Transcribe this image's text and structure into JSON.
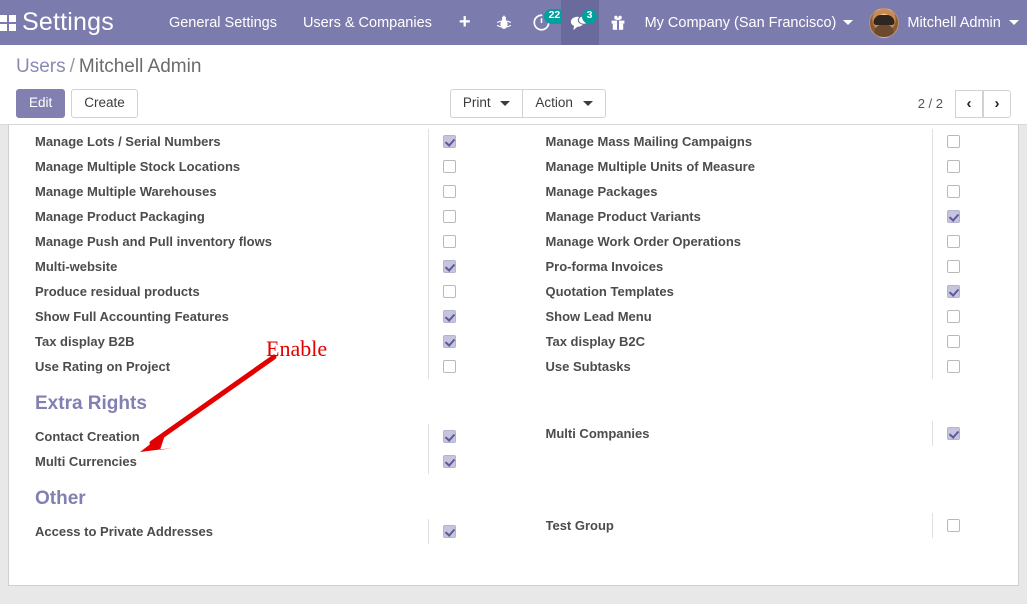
{
  "navbar": {
    "apps_icon": "apps-grid-icon",
    "app_title": "Settings",
    "menu_items": [
      {
        "label": "General Settings"
      },
      {
        "label": "Users & Companies"
      }
    ],
    "add_label": "+",
    "sys_icons": [
      {
        "name": "bug-icon",
        "glyph": "🐞",
        "badge": null,
        "active": false
      },
      {
        "name": "activity-clock-icon",
        "glyph": "⟳",
        "badge": "22",
        "active": false
      },
      {
        "name": "messages-icon",
        "glyph": "💬",
        "badge": "3",
        "active": true
      },
      {
        "name": "gift-icon",
        "glyph": "🎁",
        "badge": null,
        "active": false
      }
    ],
    "company": "My Company (San Francisco)",
    "user": "Mitchell Admin"
  },
  "control_panel": {
    "breadcrumb_root": "Users",
    "breadcrumb_sep": "/",
    "breadcrumb_current": "Mitchell Admin",
    "edit_label": "Edit",
    "create_label": "Create",
    "print_label": "Print",
    "action_label": "Action",
    "pager_count": "2 / 2",
    "prev_glyph": "‹",
    "next_glyph": "›"
  },
  "form": {
    "left_column": [
      {
        "label": "Manage Lots / Serial Numbers",
        "checked": true
      },
      {
        "label": "Manage Multiple Stock Locations",
        "checked": false
      },
      {
        "label": "Manage Multiple Warehouses",
        "checked": false
      },
      {
        "label": "Manage Product Packaging",
        "checked": false
      },
      {
        "label": "Manage Push and Pull inventory flows",
        "checked": false
      },
      {
        "label": "Multi-website",
        "checked": true
      },
      {
        "label": "Produce residual products",
        "checked": false
      },
      {
        "label": "Show Full Accounting Features",
        "checked": true
      },
      {
        "label": "Tax display B2B",
        "checked": true
      },
      {
        "label": "Use Rating on Project",
        "checked": false
      }
    ],
    "right_column": [
      {
        "label": "Manage Mass Mailing Campaigns",
        "checked": false
      },
      {
        "label": "Manage Multiple Units of Measure",
        "checked": false
      },
      {
        "label": "Manage Packages",
        "checked": false
      },
      {
        "label": "Manage Product Variants",
        "checked": true
      },
      {
        "label": "Manage Work Order Operations",
        "checked": false
      },
      {
        "label": "Pro-forma Invoices",
        "checked": false
      },
      {
        "label": "Quotation Templates",
        "checked": true
      },
      {
        "label": "Show Lead Menu",
        "checked": false
      },
      {
        "label": "Tax display B2C",
        "checked": false
      },
      {
        "label": "Use Subtasks",
        "checked": false
      }
    ],
    "extra_rights_title": "Extra Rights",
    "extra_rights_left": [
      {
        "label": "Contact Creation",
        "checked": true
      },
      {
        "label": "Multi Currencies",
        "checked": true
      }
    ],
    "extra_rights_right": [
      {
        "label": "Multi Companies",
        "checked": true
      }
    ],
    "other_title": "Other",
    "other_left": [
      {
        "label": "Access to Private Addresses",
        "checked": true
      }
    ],
    "other_right": [
      {
        "label": "Test Group",
        "checked": false
      }
    ]
  },
  "annotation": {
    "text": "Enable",
    "color": "#e30000"
  },
  "colors": {
    "brand_purple": "#7c7bad",
    "badge_teal": "#00a09d",
    "section_heading": "#8280b0",
    "annotation_red": "#e30000"
  }
}
